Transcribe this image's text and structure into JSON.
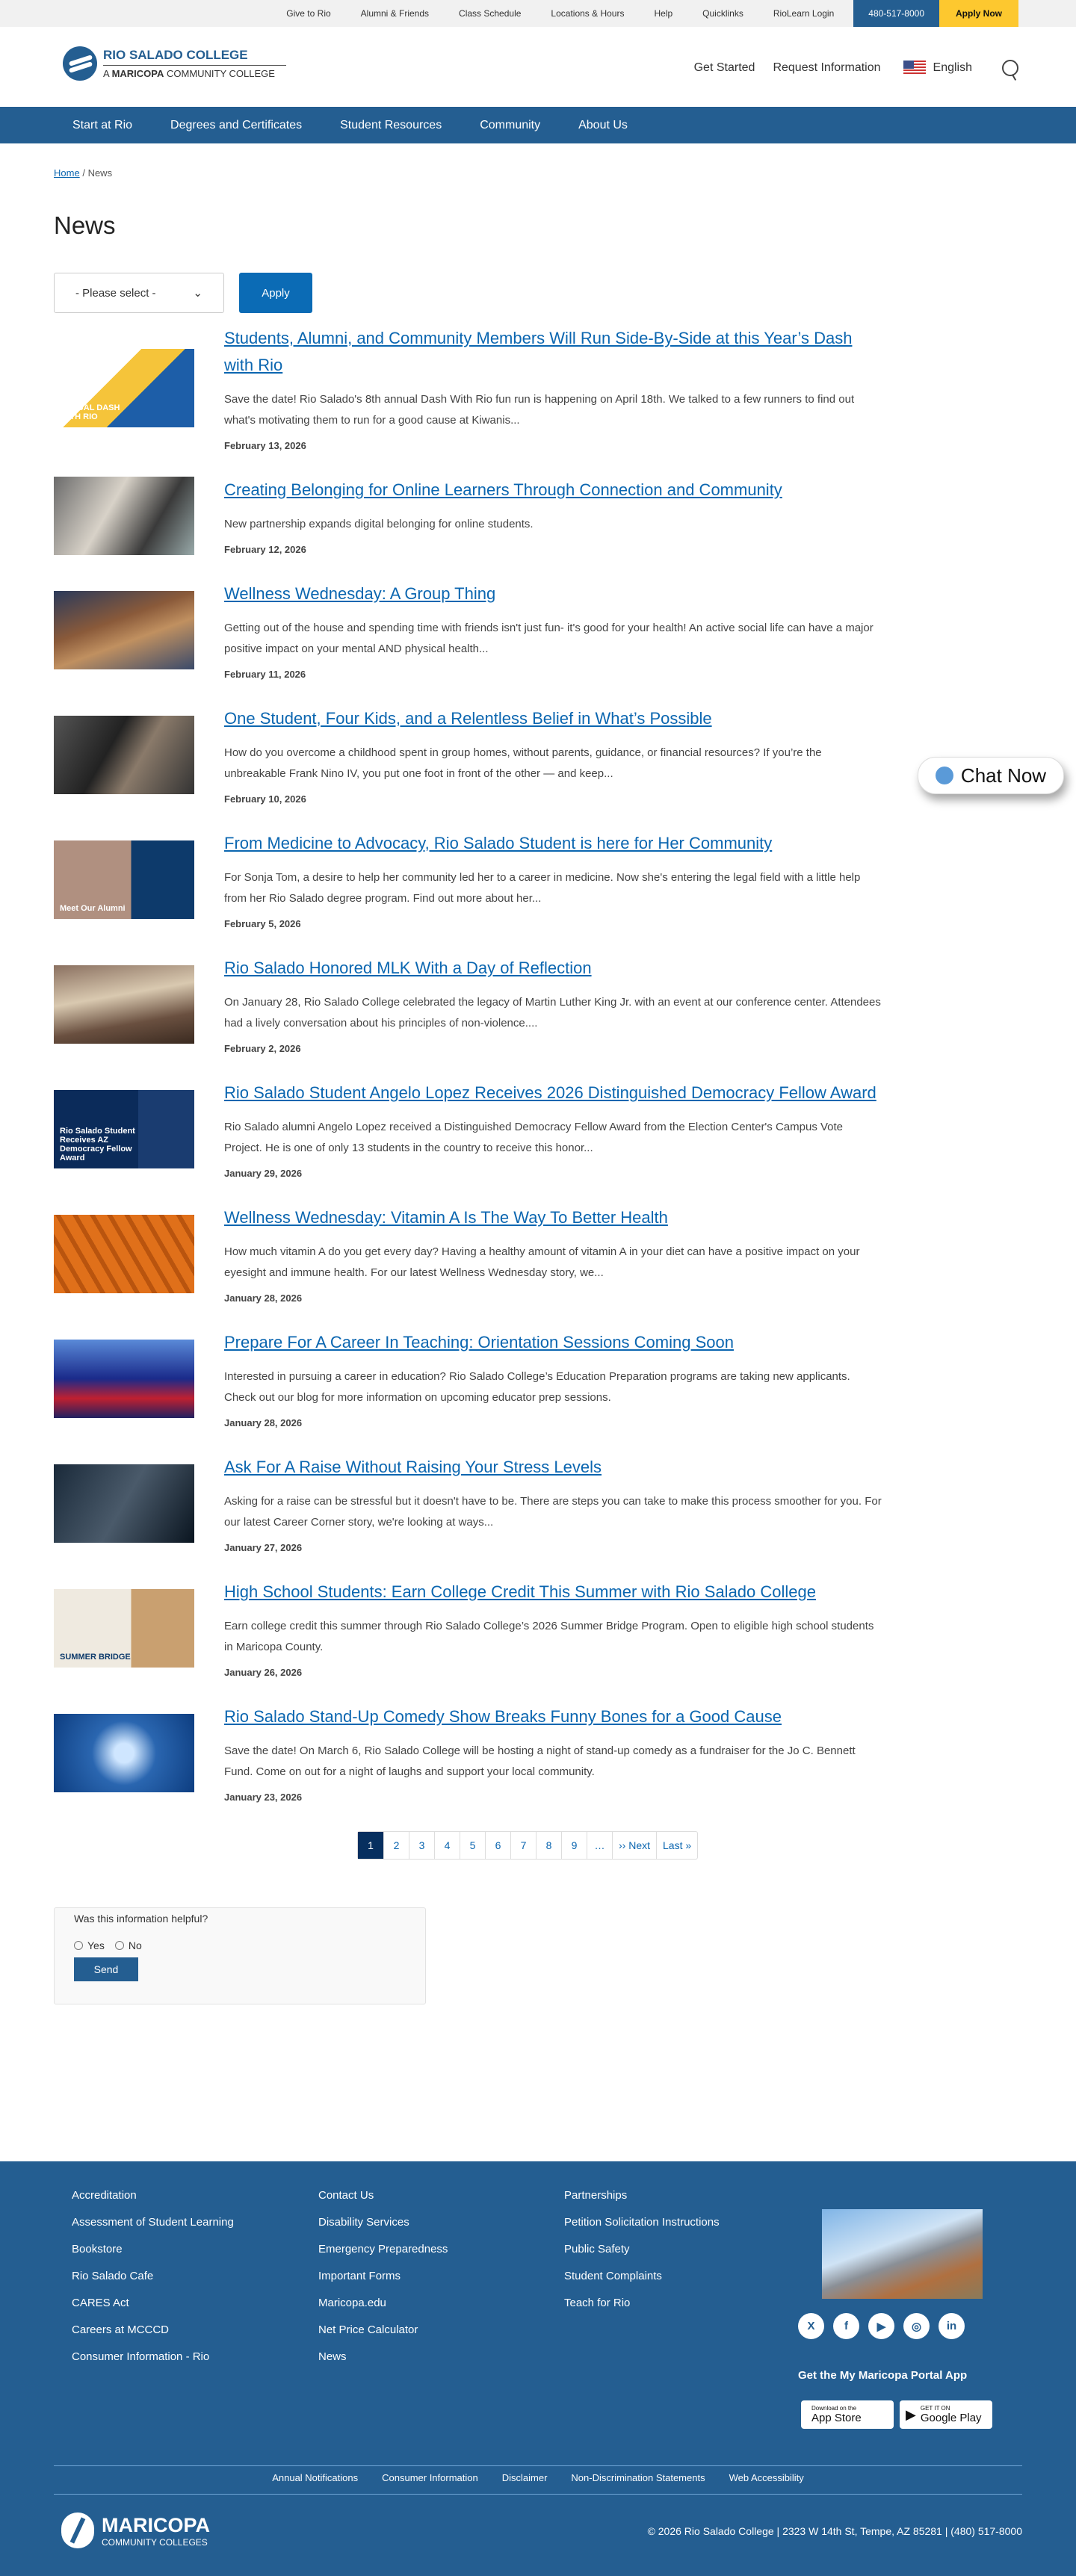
{
  "topbar": {
    "links": [
      "Give to Rio",
      "Alumni & Friends",
      "Class Schedule",
      "Locations & Hours",
      "Help",
      "Quicklinks",
      "RioLearn Login"
    ],
    "phone": "480-517-8000",
    "apply": "Apply Now"
  },
  "logo": {
    "name": "RIO SALADO COLLEGE",
    "sub_pre": "A ",
    "sub_bold": "MARICOPA",
    "sub_post": " COMMUNITY COLLEGE"
  },
  "header": {
    "get_started": "Get Started",
    "request_info": "Request Information",
    "language": "English"
  },
  "nav": [
    "Start at Rio",
    "Degrees and Certificates",
    "Student Resources",
    "Community",
    "About Us"
  ],
  "breadcrumb": {
    "home": "Home",
    "sep": "/",
    "current": "News"
  },
  "page_title": "News",
  "filter": {
    "select_value": "- Please select -",
    "apply": "Apply"
  },
  "articles": [
    {
      "title": "Students, Alumni, and Community Members Will Run Side-By-Side at this Year’s Dash with Rio",
      "excerpt": "Save the date! Rio Salado's 8th annual Dash With Rio fun run is happening on April 18th. We talked to a few runners to find out what's motivating them to run for a good cause at Kiwanis...",
      "date": "February 13, 2026",
      "thumb_text": "ANNUAL DASH WITH RIO"
    },
    {
      "title": "Creating Belonging for Online Learners Through Connection and Community",
      "excerpt": "New partnership expands digital belonging for online students.",
      "date": "February 12, 2026"
    },
    {
      "title": "Wellness Wednesday: A Group Thing",
      "excerpt": "Getting out of the house and spending time with friends isn't just fun- it's good for your health! An active social life can have a major positive impact on your mental AND physical health...",
      "date": "February 11, 2026"
    },
    {
      "title": "One Student, Four Kids, and a Relentless Belief in What’s Possible",
      "excerpt": "How do you overcome a childhood spent in group homes, without parents, guidance, or financial resources? If you’re the unbreakable Frank Nino IV, you put one foot in front of the other — and keep...",
      "date": "February 10, 2026"
    },
    {
      "title": "From Medicine to Advocacy, Rio Salado Student is here for Her Community",
      "excerpt": "For Sonja Tom, a desire to help her community led her to a career in medicine. Now she's entering the legal field with a little help from her Rio Salado degree program. Find out more about her...",
      "date": "February 5, 2026",
      "thumb_text": "Meet Our Alumni"
    },
    {
      "title": "Rio Salado Honored MLK With a Day of Reflection",
      "excerpt": "On January 28, Rio Salado College celebrated the legacy of Martin Luther King Jr. with an event at our conference center. Attendees had a lively conversation about his principles of non-violence....",
      "date": "February 2, 2026"
    },
    {
      "title": "Rio Salado Student Angelo Lopez Receives 2026 Distinguished Democracy Fellow Award",
      "excerpt": "Rio Salado alumni Angelo Lopez received a Distinguished Democracy Fellow Award from the Election Center's Campus Vote Project. He is one of only 13 students in the country to receive this honor...",
      "date": "January 29, 2026",
      "thumb_text": "Rio Salado Student Receives AZ Democracy Fellow Award"
    },
    {
      "title": "Wellness Wednesday: Vitamin A Is The Way To Better Health",
      "excerpt": "How much vitamin A do you get every day? Having a healthy amount of vitamin A in your diet can have a positive impact on your eyesight and immune health. For our latest Wellness Wednesday story, we...",
      "date": "January 28, 2026"
    },
    {
      "title": "Prepare For A Career In Teaching: Orientation Sessions Coming Soon",
      "excerpt": "Interested in pursuing a career in education? Rio Salado College’s Education Preparation programs are taking new applicants. Check out our blog for more information on upcoming educator prep sessions.",
      "date": "January 28, 2026"
    },
    {
      "title": "Ask For A Raise Without Raising Your Stress Levels",
      "excerpt": "Asking for a raise can be stressful but it doesn't have to be. There are steps you can take to make this process smoother for you. For our latest Career Corner story, we're looking at ways...",
      "date": "January 27, 2026"
    },
    {
      "title": "High School Students: Earn College Credit This Summer with Rio Salado College",
      "excerpt": "Earn college credit this summer through Rio Salado College’s 2026 Summer Bridge Program. Open to eligible high school students in Maricopa County.",
      "date": "January 26, 2026",
      "thumb_text": "SUMMER BRIDGE"
    },
    {
      "title": "Rio Salado Stand-Up Comedy Show Breaks Funny Bones for a Good Cause",
      "excerpt": "Save the date! On March 6, Rio Salado College will be hosting a night of stand-up comedy as a fundraiser for the Jo C. Bennett Fund. Come on out for a night of laughs and support your local community.",
      "date": "January 23, 2026"
    }
  ],
  "pager": [
    "1",
    "2",
    "3",
    "4",
    "5",
    "6",
    "7",
    "8",
    "9",
    "…",
    "›› Next",
    "Last »"
  ],
  "pager_current": 1,
  "feedback": {
    "question": "Was this information helpful?",
    "yes": "Yes",
    "no": "No",
    "send": "Send"
  },
  "chat": {
    "label": "Chat Now"
  },
  "footer": {
    "col1": [
      "Accreditation",
      "Assessment of Student Learning",
      "Bookstore",
      "Rio Salado Cafe",
      "CARES Act",
      "Careers at MCCCD",
      "Consumer Information - Rio"
    ],
    "col2": [
      "Contact Us",
      "Disability Services",
      "Emergency Preparedness",
      "Important Forms",
      "Maricopa.edu",
      "Net Price Calculator",
      "News"
    ],
    "col3": [
      "Partnerships",
      "Petition Solicitation Instructions",
      "Public Safety",
      "Student Complaints",
      "Teach for Rio"
    ],
    "social": [
      "x-icon",
      "facebook-icon",
      "youtube-icon",
      "instagram-icon",
      "linkedin-icon"
    ],
    "app_label": "Get the My Maricopa Portal App",
    "appstore": {
      "small": "Download on the",
      "big": "App Store"
    },
    "googleplay": {
      "small": "GET IT ON",
      "big": "Google Play"
    },
    "bottom_links": [
      "Annual Notifications",
      "Consumer Information",
      "Disclaimer",
      "Non-Discrimination Statements",
      "Web Accessibility"
    ],
    "logo_name": "MARICOPA",
    "logo_sub": "COMMUNITY COLLEGES",
    "copyright": "© 2026 Rio Salado College | 2323 W 14th St, Tempe, AZ 85281 | (480) 517-8000"
  },
  "colors": {
    "brand": "#245e91",
    "link": "#0b66b0",
    "apply": "#fdc82f",
    "pager_active": "#072f5f"
  }
}
